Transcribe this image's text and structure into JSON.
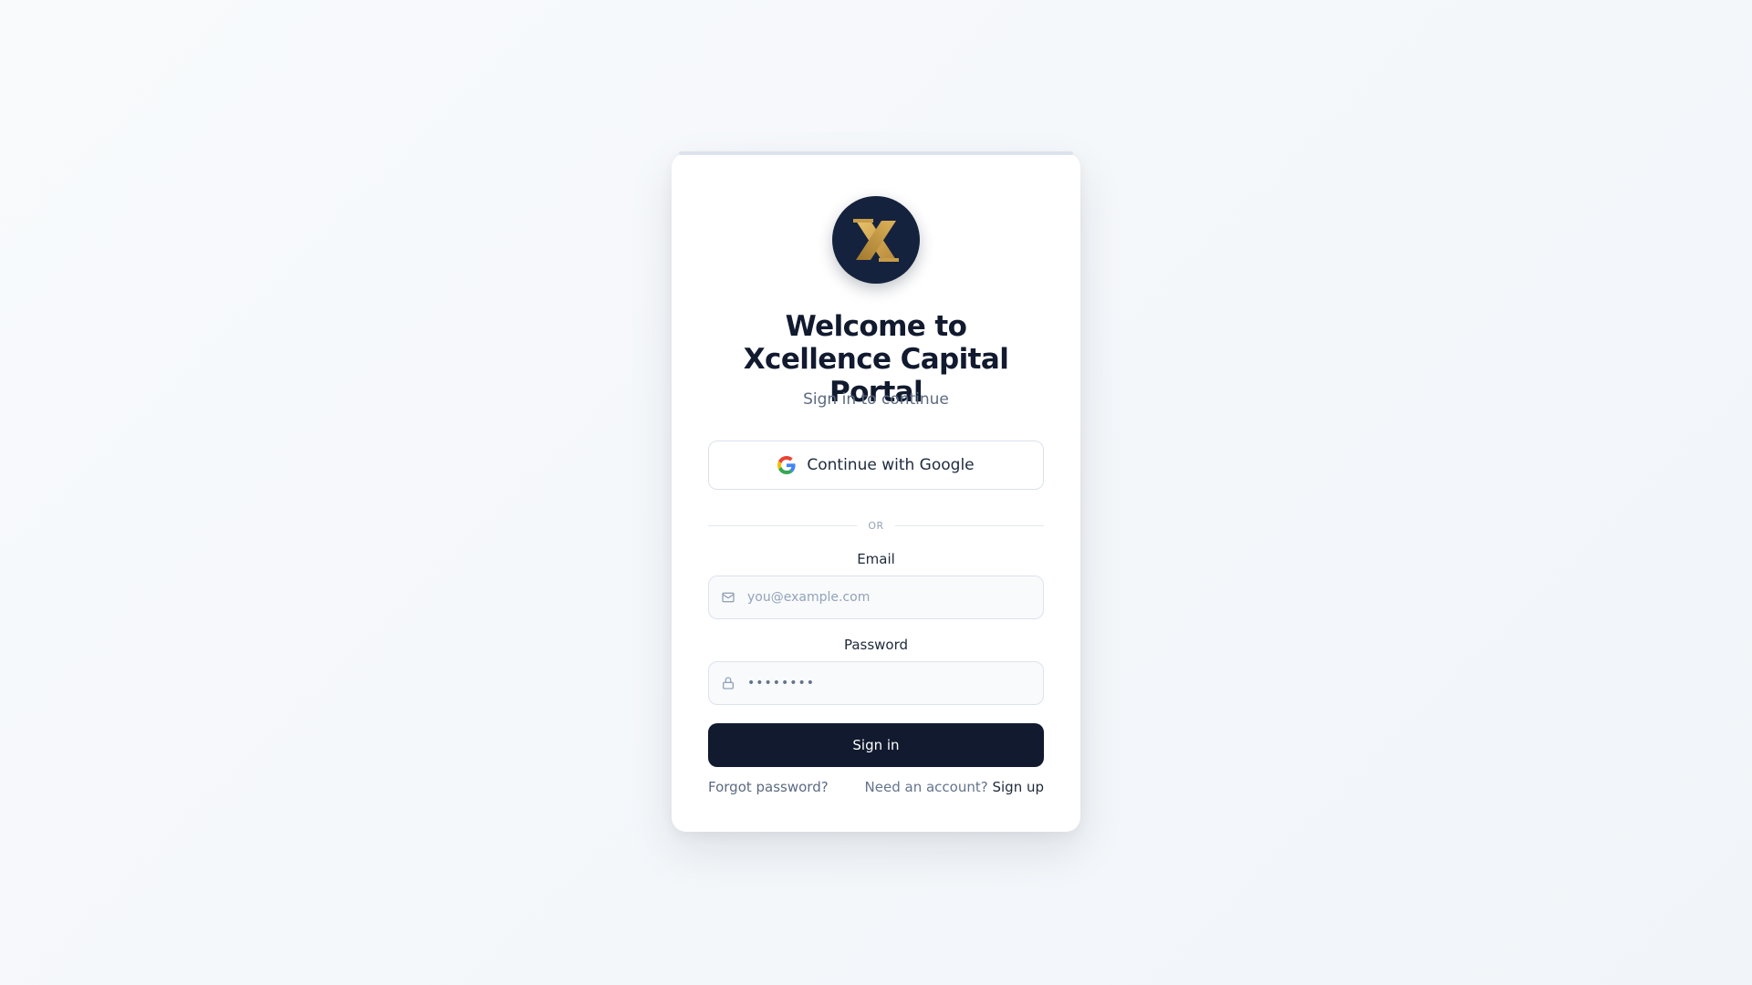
{
  "brand": {
    "logo_icon": "x-monogram-icon",
    "colors": {
      "primary": "#111a2e",
      "logo_background": "#14223d",
      "logo_gold": "#d4a84a",
      "page_background": "#f5f7fa"
    }
  },
  "header": {
    "title": "Welcome to Xcellence Capital Portal",
    "subtitle": "Sign in to continue"
  },
  "google_button": {
    "label": "Continue with Google",
    "icon": "google-icon"
  },
  "divider": {
    "text": "OR"
  },
  "form": {
    "email": {
      "label": "Email",
      "placeholder": "you@example.com",
      "icon": "mail-icon"
    },
    "password": {
      "label": "Password",
      "value": "••••••••",
      "icon": "lock-icon"
    },
    "submit_label": "Sign in"
  },
  "footer": {
    "forgot_password": "Forgot password?",
    "signup_prompt": "Need an account?",
    "signup_link": "Sign up"
  }
}
